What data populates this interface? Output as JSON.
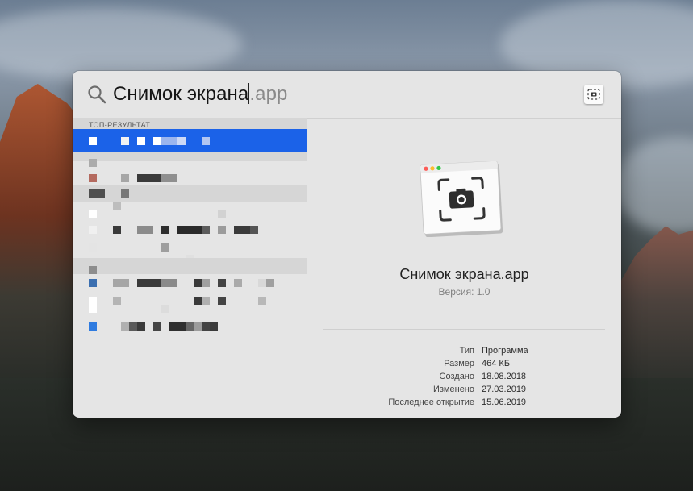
{
  "search": {
    "query": "Снимок экрана",
    "completion": ".app"
  },
  "results": {
    "top_hit_label": "ТОП-РЕЗУЛЬТАТ"
  },
  "preview": {
    "title": "Снимок экрана.app",
    "version": "Версия: 1.0",
    "info": [
      {
        "label": "Тип",
        "value": "Программа"
      },
      {
        "label": "Размер",
        "value": "464 КБ"
      },
      {
        "label": "Создано",
        "value": "18.08.2018"
      },
      {
        "label": "Изменено",
        "value": "27.03.2019"
      },
      {
        "label": "Последнее открытие",
        "value": "15.06.2019"
      }
    ]
  },
  "icons": {
    "search": "magnifier-icon",
    "app": "screenshot-app-icon"
  },
  "colors": {
    "selection": "#1b62e8",
    "panel": "#e5e5e5",
    "sectionHeader": "#d6d6d6"
  }
}
